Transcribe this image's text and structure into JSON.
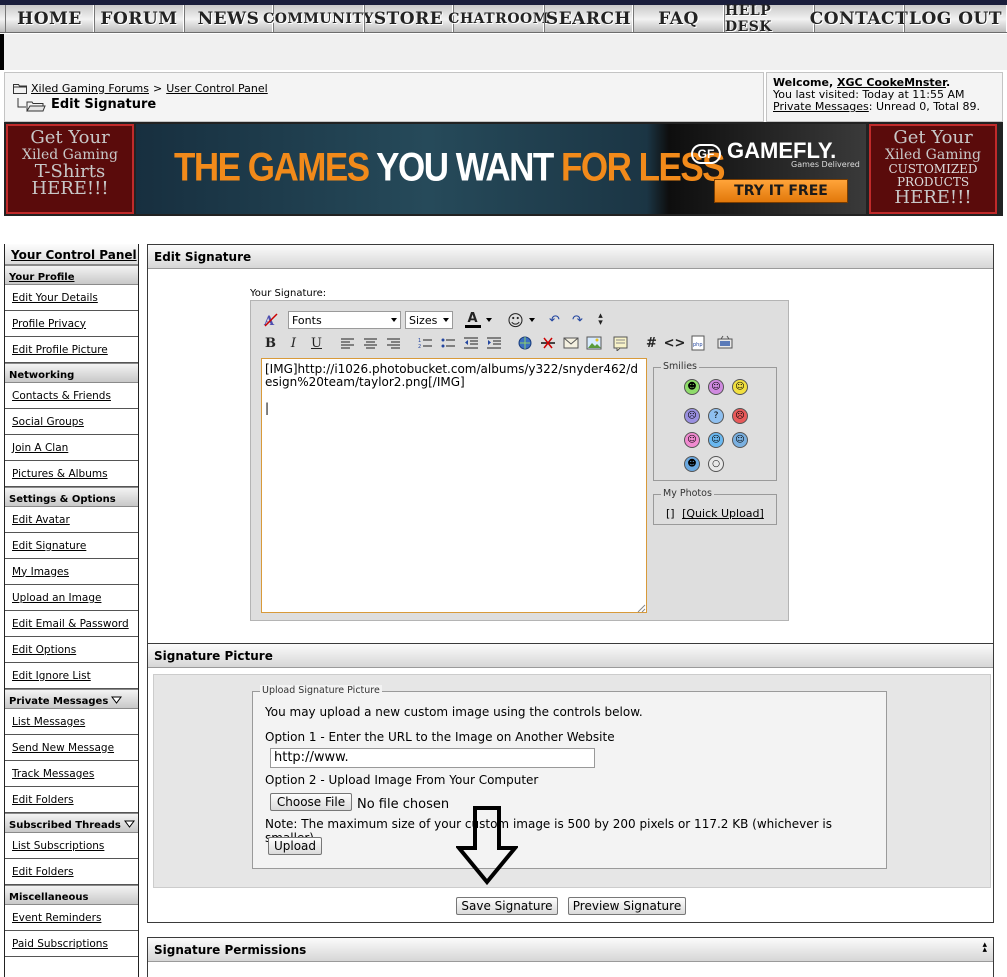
{
  "nav": [
    "HOME",
    "FORUM",
    "NEWS",
    "COMMUNITY",
    "STORE",
    "CHATROOM",
    "SEARCH",
    "FAQ",
    "HELP DESK",
    "CONTACT",
    "LOG OUT"
  ],
  "breadcrumb": {
    "forum": "Xiled Gaming Forums",
    "sep": ">",
    "ucp": "User Control Panel",
    "current": "Edit Signature"
  },
  "welcome": {
    "prefix": "Welcome, ",
    "user": "XGC CookeMnster",
    "suffix": ".",
    "last_visited": "You last visited: Today at 11:55 AM",
    "pm_link": "Private Messages",
    "pm_info": ": Unread 0, Total 89."
  },
  "ads": {
    "left": [
      "Get Your",
      "Xiled Gaming",
      "T-Shirts",
      "HERE!!!"
    ],
    "right": [
      "Get Your",
      "Xiled Gaming",
      "CUSTOMIZED PRODUCTS",
      "HERE!!!"
    ],
    "gamefly": {
      "t1": "THE GAMES ",
      "t2": "YOU WANT ",
      "t3": "FOR LESS",
      "logo": "GAMEFLY.",
      "logo_sub": "Games Delivered",
      "cta": "TRY IT FREE"
    }
  },
  "sidebar": {
    "title": "Your Control Panel",
    "sections": [
      {
        "title": "Your Profile",
        "link": true,
        "items": [
          "Edit Your Details",
          "Profile Privacy",
          "Edit Profile Picture"
        ]
      },
      {
        "title": "Networking",
        "items": [
          "Contacts & Friends",
          "Social Groups",
          "Join A Clan",
          "Pictures & Albums"
        ]
      },
      {
        "title": "Settings & Options",
        "items": [
          "Edit Avatar",
          "Edit Signature",
          "My Images",
          "Upload an Image",
          "Edit Email & Password",
          "Edit Options",
          "Edit Ignore List"
        ]
      },
      {
        "title": "Private Messages",
        "items": [
          "List Messages",
          "Send New Message",
          "Track Messages",
          "Edit Folders"
        ]
      },
      {
        "title": "Subscribed Threads",
        "items": [
          "List Subscriptions",
          "Edit Folders"
        ]
      },
      {
        "title": "Miscellaneous",
        "items": [
          "Event Reminders",
          "Paid Subscriptions"
        ]
      }
    ]
  },
  "edit_signature": {
    "heading": "Edit Signature",
    "label": "Your Signature:",
    "fonts": "Fonts",
    "sizes": "Sizes",
    "text": "[IMG]http://i1026.photobucket.com/albums/y322/snyder462/design%20team/taylor2.png[/IMG]\n\n|",
    "smilies_label": "Smilies",
    "photos_label": "My Photos",
    "photos_brackets": "[]",
    "quick_upload": "[Quick Upload]"
  },
  "signature_picture": {
    "heading": "Signature Picture",
    "legend": "Upload Signature Picture",
    "intro": "You may upload a new custom image using the controls below.",
    "option1": "Option 1 - Enter the URL to the Image on Another Website",
    "url_value": "http://www.",
    "option2": "Option 2 - Upload Image From Your Computer",
    "choose_file": "Choose File",
    "no_file": "No file chosen",
    "note": "Note: The maximum size of your custom image is 500 by 200 pixels or 117.2 KB (whichever is smaller).",
    "upload": "Upload"
  },
  "actions": {
    "save": "Save Signature",
    "preview": "Preview Signature"
  },
  "permissions": {
    "heading": "Signature Permissions"
  }
}
